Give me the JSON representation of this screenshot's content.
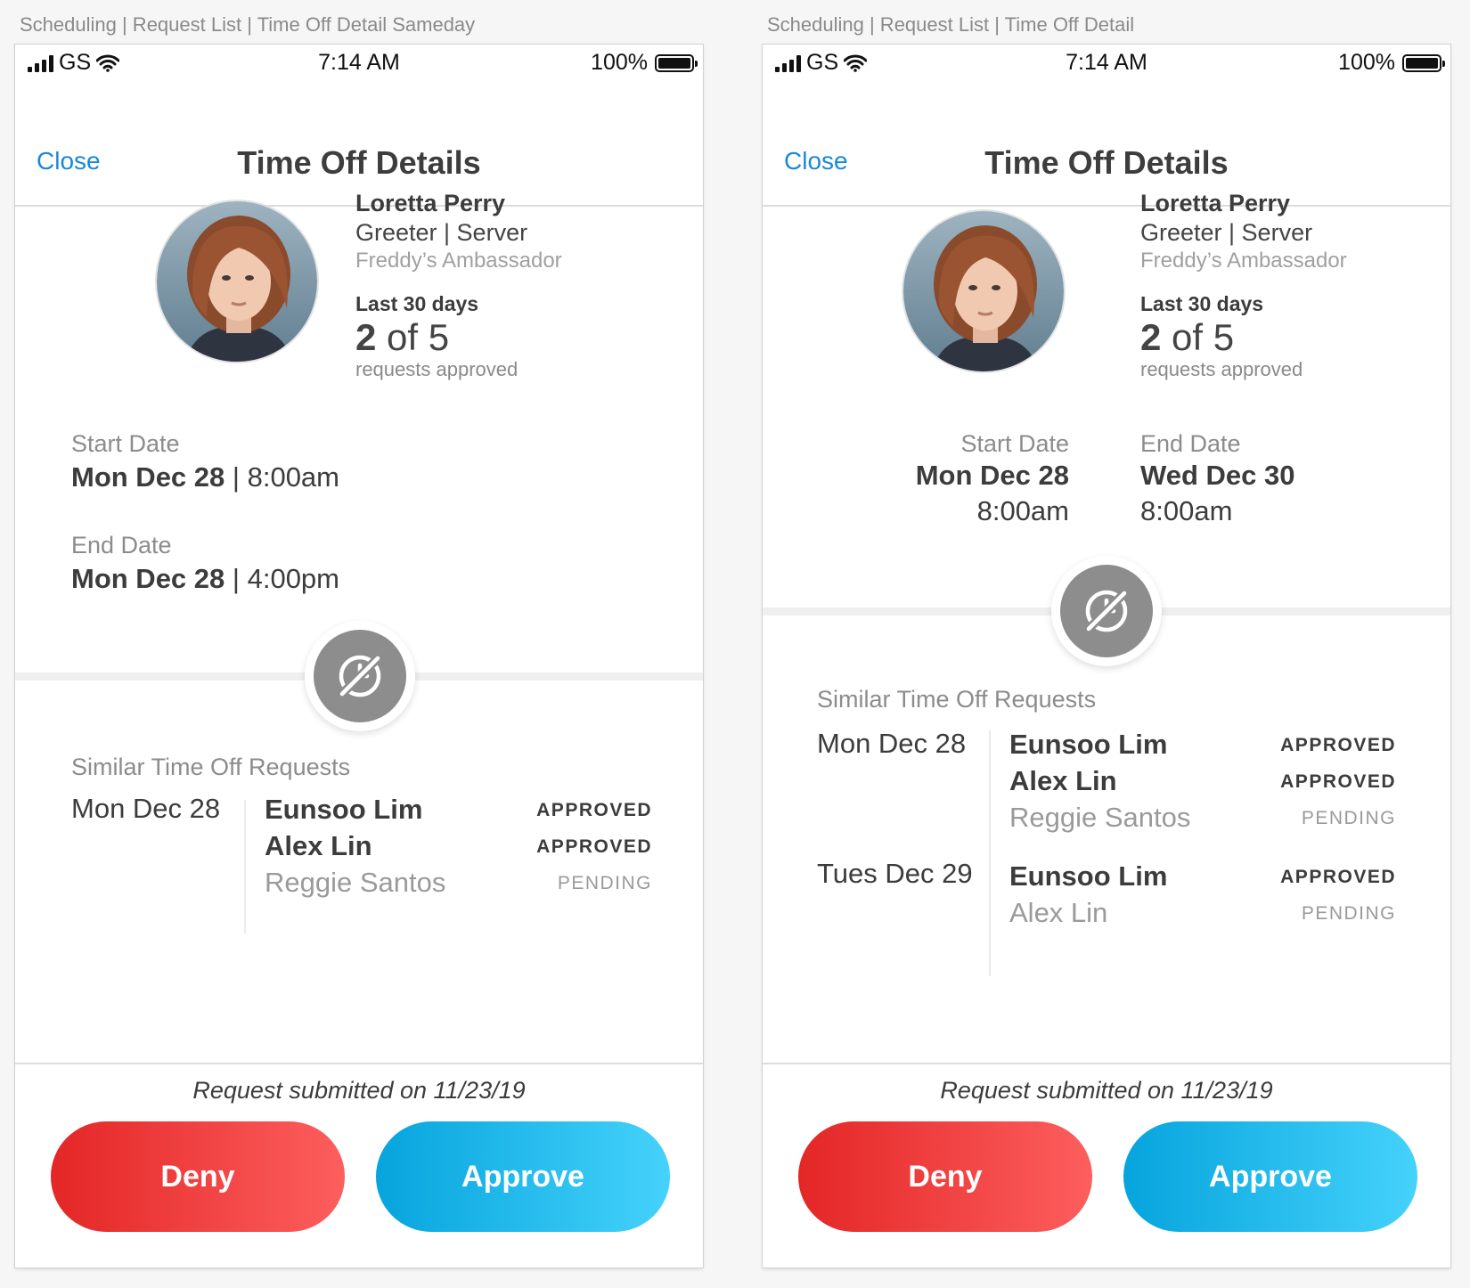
{
  "screens": [
    {
      "caption": "Scheduling | Request List | Time Off Detail Sameday",
      "status_bar": {
        "carrier": "GS",
        "time": "7:14 AM",
        "battery": "100%"
      },
      "nav": {
        "close_label": "Close",
        "title": "Time Off Details"
      },
      "employee": {
        "name": "Loretta Perry",
        "role": "Greeter | Server",
        "team": "Freddy’s Ambassador",
        "period_label": "Last 30 days",
        "approved_count": "2",
        "count_of": "of 5",
        "count_label": "requests approved"
      },
      "start": {
        "label": "Start Date",
        "day": "Mon Dec 28",
        "sep": "|",
        "time": "8:00am"
      },
      "end": {
        "label": "End Date",
        "day": "Mon Dec 28",
        "sep": "|",
        "time": "4:00pm"
      },
      "similar": {
        "title": "Similar Time Off Requests",
        "groups": [
          {
            "date": "Mon Dec 28",
            "rows": [
              {
                "name": "Eunsoo Lim",
                "status": "APPROVED"
              },
              {
                "name": "Alex Lin",
                "status": "APPROVED"
              },
              {
                "name": "Reggie Santos",
                "status": "PENDING"
              }
            ]
          }
        ]
      },
      "footer": {
        "submitted": "Request submitted on 11/23/19",
        "deny_label": "Deny",
        "approve_label": "Approve"
      }
    },
    {
      "caption": "Scheduling | Request List | Time Off Detail",
      "status_bar": {
        "carrier": "GS",
        "time": "7:14 AM",
        "battery": "100%"
      },
      "nav": {
        "close_label": "Close",
        "title": "Time Off Details"
      },
      "employee": {
        "name": "Loretta Perry",
        "role": "Greeter | Server",
        "team": "Freddy’s Ambassador",
        "period_label": "Last 30 days",
        "approved_count": "2",
        "count_of": "of 5",
        "count_label": "requests approved"
      },
      "start": {
        "label": "Start Date",
        "day": "Mon Dec 28",
        "time": "8:00am"
      },
      "end": {
        "label": "End Date",
        "day": "Wed Dec 30",
        "time": "8:00am"
      },
      "similar": {
        "title": "Similar Time Off Requests",
        "groups": [
          {
            "date": "Mon Dec 28",
            "rows": [
              {
                "name": "Eunsoo Lim",
                "status": "APPROVED"
              },
              {
                "name": "Alex Lin",
                "status": "APPROVED"
              },
              {
                "name": "Reggie Santos",
                "status": "PENDING"
              }
            ]
          },
          {
            "date": "Tues Dec 29",
            "rows": [
              {
                "name": "Eunsoo Lim",
                "status": "APPROVED"
              },
              {
                "name": "Alex Lin",
                "status": "PENDING"
              }
            ]
          }
        ]
      },
      "footer": {
        "submitted": "Request submitted on 11/23/19",
        "deny_label": "Deny",
        "approve_label": "Approve"
      }
    }
  ],
  "icons": {
    "signal": "signal-bars-icon",
    "wifi": "wifi-icon",
    "battery": "battery-icon",
    "badge": "no-overtime-icon"
  },
  "colors": {
    "link": "#1a88d8",
    "deny_start": "#e42626",
    "deny_end": "#fd5e5e",
    "approve_start": "#06a4dd",
    "approve_end": "#45d2fb",
    "badge": "#8d8d8d"
  }
}
